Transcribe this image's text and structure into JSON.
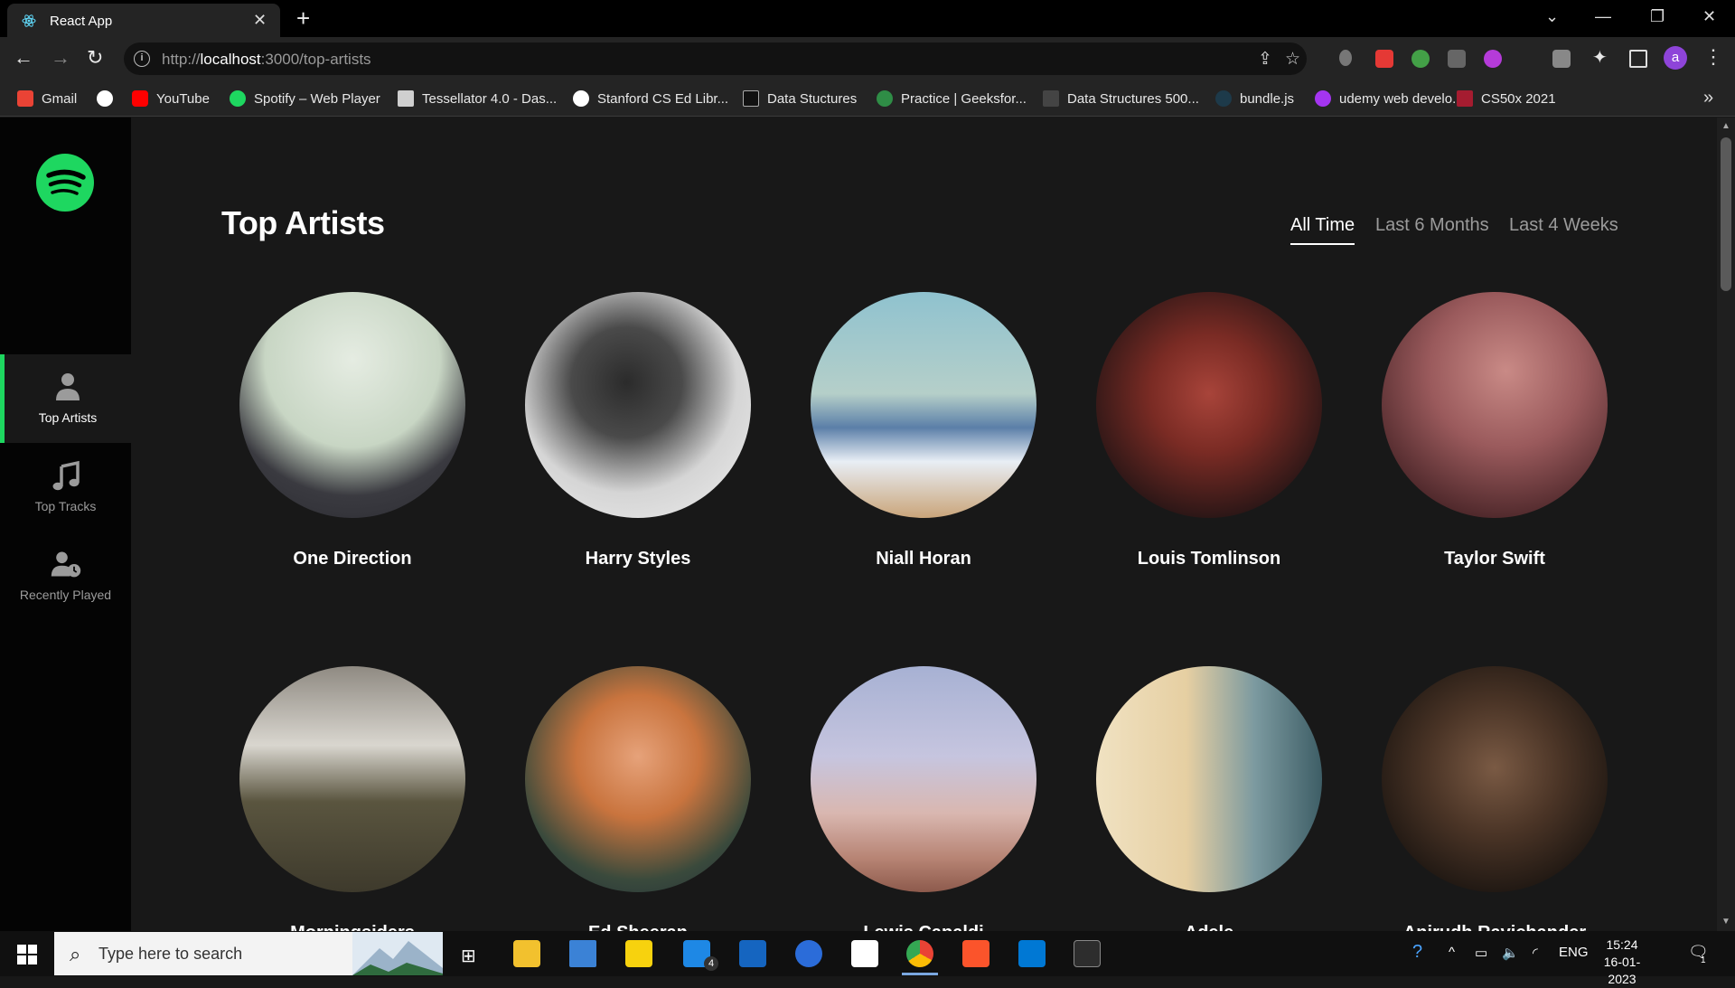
{
  "browser": {
    "tab_title": "React App",
    "url_prefix": "http://",
    "url_host": "localhost",
    "url_path": ":3000/top-artists",
    "profile_initial": "a",
    "bookmarks": [
      {
        "label": "Gmail",
        "icon": "gmail-icon",
        "color": "#ea4335"
      },
      {
        "label": "",
        "icon": "globe-icon",
        "color": "#ffffff"
      },
      {
        "label": "YouTube",
        "icon": "youtube-icon",
        "color": "#ff0000"
      },
      {
        "label": "Spotify – Web Player",
        "icon": "spotify-icon",
        "color": "#1ed760"
      },
      {
        "label": "Tessellator 4.0 - Das...",
        "icon": "tessellator-icon",
        "color": "#cfcfcf"
      },
      {
        "label": "Stanford CS Ed Libr...",
        "icon": "globe-icon",
        "color": "#ffffff"
      },
      {
        "label": "Data Stuctures",
        "icon": "data-structures-icon",
        "color": "#111111"
      },
      {
        "label": "Practice | Geeksfor...",
        "icon": "geeksforgeeks-icon",
        "color": "#2f8d46"
      },
      {
        "label": "Data Structures 500...",
        "icon": "bookmark-icon",
        "color": "#444444"
      },
      {
        "label": "bundle.js",
        "icon": "react-icon",
        "color": "#61dafb"
      },
      {
        "label": "udemy web develo...",
        "icon": "udemy-icon",
        "color": "#a435f0"
      },
      {
        "label": "CS50x 2021",
        "icon": "harvard-icon",
        "color": "#a51c30"
      }
    ]
  },
  "sidebar": {
    "items": [
      {
        "label": "Top Artists",
        "icon": "user-icon"
      },
      {
        "label": "Top Tracks",
        "icon": "music-note-icon"
      },
      {
        "label": "Recently Played",
        "icon": "user-clock-icon"
      }
    ]
  },
  "main": {
    "title": "Top Artists",
    "range_tabs": [
      "All Time",
      "Last 6 Months",
      "Last 4 Weeks"
    ],
    "artists": [
      {
        "name": "One Direction",
        "palette": [
          "#dfe8dc",
          "#3a3a40"
        ]
      },
      {
        "name": "Harry Styles",
        "palette": [
          "#e9e9e9",
          "#2b2b2b"
        ]
      },
      {
        "name": "Niall Horan",
        "palette": [
          "#7fb5c7",
          "#d8c8a8"
        ]
      },
      {
        "name": "Louis Tomlinson",
        "palette": [
          "#2a1616",
          "#b8423a"
        ]
      },
      {
        "name": "Taylor Swift",
        "palette": [
          "#3d1f22",
          "#b26a6e"
        ]
      },
      {
        "name": "Morningsiders",
        "palette": [
          "#c9c5bd",
          "#4a4638"
        ]
      },
      {
        "name": "Ed Sheeran",
        "palette": [
          "#1e2a38",
          "#d68a4a"
        ]
      },
      {
        "name": "Lewis Capaldi",
        "palette": [
          "#b8bfd8",
          "#c49a86"
        ]
      },
      {
        "name": "Adele",
        "palette": [
          "#5a7e86",
          "#e8d5b0"
        ]
      },
      {
        "name": "Anirudh Ravichander",
        "palette": [
          "#1a1410",
          "#5b4332"
        ]
      }
    ]
  },
  "taskbar": {
    "search_placeholder": "Type here to search",
    "language": "ENG",
    "time": "15:24",
    "date": "16-01-2023",
    "mail_badge": "4",
    "notification_count": "1"
  }
}
